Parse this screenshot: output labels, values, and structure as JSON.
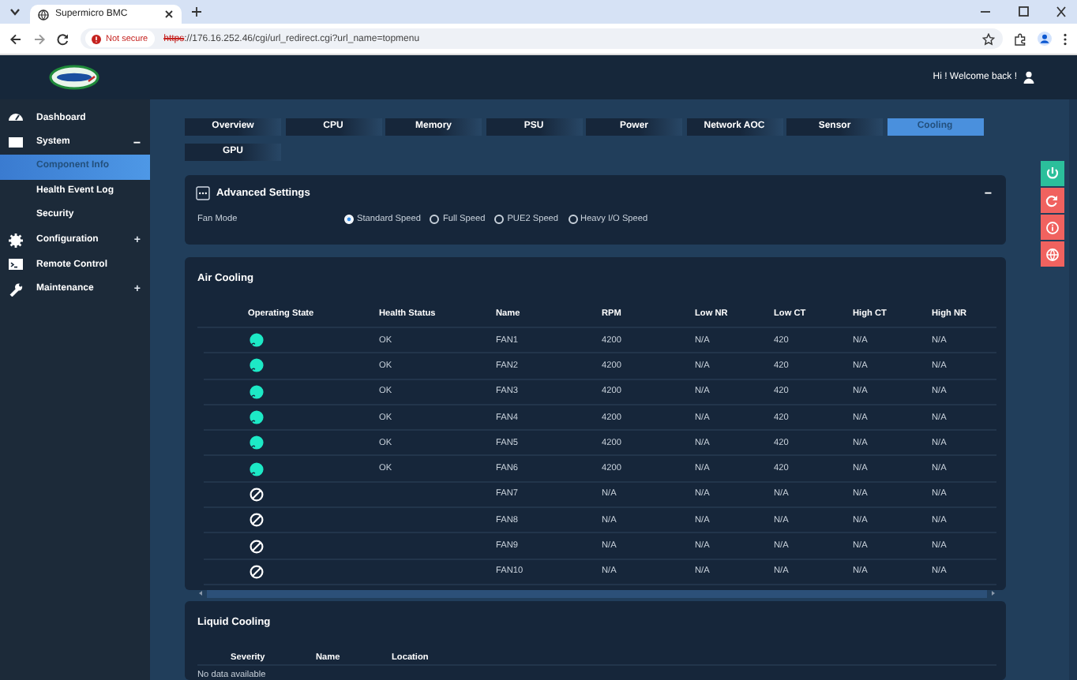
{
  "browser": {
    "tab_title": "Supermicro BMC",
    "security": "Not secure",
    "url_scheme": "https",
    "url_rest": "://176.16.252.46/cgi/url_redirect.cgi?url_name=topmenu"
  },
  "header": {
    "greeting": "Hi ! Welcome back !"
  },
  "sidebar": {
    "items": [
      {
        "label": "Dashboard",
        "selected": false
      },
      {
        "label": "System",
        "toggle": "−",
        "expanded": true,
        "selected": false,
        "children": [
          {
            "label": "Component Info",
            "selected": true
          },
          {
            "label": "Health Event Log",
            "selected": false
          },
          {
            "label": "Security",
            "selected": false
          }
        ]
      },
      {
        "label": "Configuration",
        "toggle": "+",
        "selected": false
      },
      {
        "label": "Remote Control",
        "selected": false
      },
      {
        "label": "Maintenance",
        "toggle": "+",
        "selected": false
      }
    ]
  },
  "tabs": [
    {
      "label": "Overview",
      "selected": false
    },
    {
      "label": "CPU",
      "selected": false
    },
    {
      "label": "Memory",
      "selected": false
    },
    {
      "label": "PSU",
      "selected": false
    },
    {
      "label": "Power",
      "selected": false
    },
    {
      "label": "Network AOC",
      "selected": false
    },
    {
      "label": "Sensor",
      "selected": false
    },
    {
      "label": "Cooling",
      "selected": true
    },
    {
      "label": "GPU",
      "selected": false
    }
  ],
  "advanced_settings": {
    "title": "Advanced Settings",
    "toggle": "−",
    "fan_mode_label": "Fan Mode",
    "options": [
      {
        "label": "Standard Speed",
        "selected": true
      },
      {
        "label": "Full Speed",
        "selected": false
      },
      {
        "label": "PUE2 Speed",
        "selected": false
      },
      {
        "label": "Heavy I/O Speed",
        "selected": false
      }
    ]
  },
  "air_cooling": {
    "title": "Air Cooling",
    "columns": [
      "Operating State",
      "Health Status",
      "Name",
      "RPM",
      "Low NR",
      "Low CT",
      "High CT",
      "High NR"
    ],
    "rows": [
      {
        "active": true,
        "health": "OK",
        "name": "FAN1",
        "rpm": "4200",
        "low_nr": "N/A",
        "low_ct": "420",
        "high_ct": "N/A",
        "high_nr": "N/A"
      },
      {
        "active": true,
        "health": "OK",
        "name": "FAN2",
        "rpm": "4200",
        "low_nr": "N/A",
        "low_ct": "420",
        "high_ct": "N/A",
        "high_nr": "N/A"
      },
      {
        "active": true,
        "health": "OK",
        "name": "FAN3",
        "rpm": "4200",
        "low_nr": "N/A",
        "low_ct": "420",
        "high_ct": "N/A",
        "high_nr": "N/A"
      },
      {
        "active": true,
        "health": "OK",
        "name": "FAN4",
        "rpm": "4200",
        "low_nr": "N/A",
        "low_ct": "420",
        "high_ct": "N/A",
        "high_nr": "N/A"
      },
      {
        "active": true,
        "health": "OK",
        "name": "FAN5",
        "rpm": "4200",
        "low_nr": "N/A",
        "low_ct": "420",
        "high_ct": "N/A",
        "high_nr": "N/A"
      },
      {
        "active": true,
        "health": "OK",
        "name": "FAN6",
        "rpm": "4200",
        "low_nr": "N/A",
        "low_ct": "420",
        "high_ct": "N/A",
        "high_nr": "N/A"
      },
      {
        "active": false,
        "name": "FAN7",
        "rpm": "N/A",
        "low_nr": "N/A",
        "low_ct": "N/A",
        "high_ct": "N/A",
        "high_nr": "N/A"
      },
      {
        "active": false,
        "name": "FAN8",
        "rpm": "N/A",
        "low_nr": "N/A",
        "low_ct": "N/A",
        "high_ct": "N/A",
        "high_nr": "N/A"
      },
      {
        "active": false,
        "name": "FAN9",
        "rpm": "N/A",
        "low_nr": "N/A",
        "low_ct": "N/A",
        "high_ct": "N/A",
        "high_nr": "N/A"
      },
      {
        "active": false,
        "name": "FAN10",
        "rpm": "N/A",
        "low_nr": "N/A",
        "low_ct": "N/A",
        "high_ct": "N/A",
        "high_nr": "N/A"
      }
    ]
  },
  "liquid_cooling": {
    "title": "Liquid Cooling",
    "columns": [
      "Severity",
      "Name",
      "Location"
    ],
    "empty_message": "No data available"
  },
  "side_actions": [
    {
      "kind": "power",
      "color": "#2bbf9b"
    },
    {
      "kind": "refresh",
      "color": "#f0625f"
    },
    {
      "kind": "info",
      "color": "#f0625f"
    },
    {
      "kind": "globe",
      "color": "#f0625f"
    }
  ]
}
